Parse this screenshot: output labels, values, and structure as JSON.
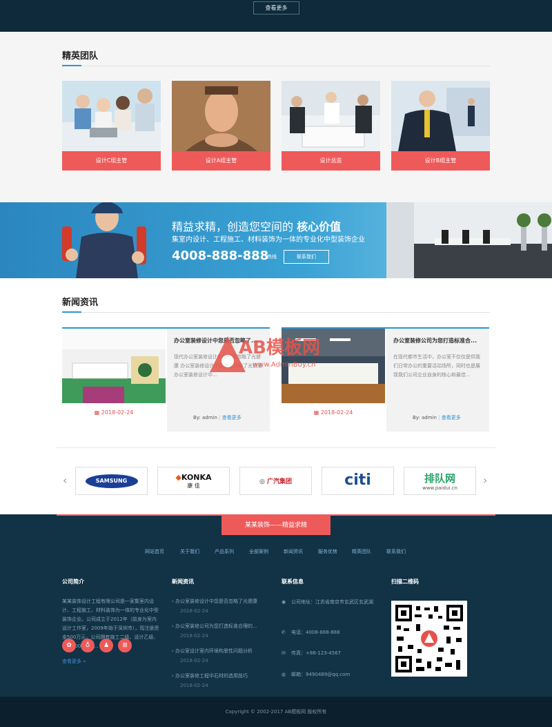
{
  "top": {
    "more_button": "查看更多"
  },
  "team": {
    "title": "精英团队",
    "members": [
      {
        "caption": "设计C组主管"
      },
      {
        "caption": "设计A组主管"
      },
      {
        "caption": "设计总监"
      },
      {
        "caption": "设计B组主管"
      }
    ]
  },
  "banner": {
    "headline_pre": "精益求精，创造您空间的",
    "headline_bold": "核心价值",
    "subline": "集室内设计、工程施工、材料装饰为一体的专业化中型装饰企业",
    "phone": "4008-888-888",
    "phone_suffix": "热线",
    "contact_button": "联系我们"
  },
  "news": {
    "title": "新闻资讯",
    "items": [
      {
        "title": "办公室装修设计中您是否忽略了...",
        "desc": "现代办公室装修设计中您是否忽略了光健康 办公室装修设计中您是否忽略了光健康 办公室装修设计中...",
        "date": "2018-02-24",
        "author": "By: admin",
        "more": "查看更多"
      },
      {
        "title": "办公室装修公司为您打造标准合...",
        "desc": "在现代都市生活中，办公室不仅仅是供我们日常办公的重要活动场所，同时也是展现我们公司企业自身的核心和最佳...",
        "date": "2018-02-24",
        "author": "By: admin",
        "more": "查看更多"
      }
    ]
  },
  "watermark": {
    "brand": "AB模板网",
    "url": "www.AdminBuy.cn"
  },
  "partners": [
    {
      "name": "SAMSUNG"
    },
    {
      "name": "KONKA",
      "sub": "康 佳"
    },
    {
      "name": "广汽集团"
    },
    {
      "name": "citi"
    },
    {
      "name": "排队网",
      "sub": "www.paidui.cn"
    }
  ],
  "footer": {
    "tagline": "某某装饰——精益求精",
    "nav": [
      "网站首页",
      "关于我们",
      "产品系列",
      "全部案例",
      "新闻资讯",
      "服务优势",
      "精英团队",
      "联系我们"
    ],
    "about_title": "公司简介",
    "about_text": "某某装饰设计工程有限公司是一家集室内设计、工程施工、材料装饰为一体的专业化中型装饰企业。公司成立于2012年（前身为室内设计工作室，2009年始于深圳市），现注册资金500万元，公司拥有施工二级、设计乙级、承接1000万元...",
    "about_more": "查看更多 »",
    "news_title": "新闻资讯",
    "news_list": [
      {
        "title": "办公室装修设计中您是否忽略了光健康",
        "date": "2018-02-24"
      },
      {
        "title": "办公室装修公司为您打造标准合理的...",
        "date": "2018-02-24"
      },
      {
        "title": "办公室设计室内环境构思性问题分析",
        "date": "2018-02-24"
      },
      {
        "title": "办公室装修工程中石材的选用技巧",
        "date": "2018-02-24"
      }
    ],
    "contact_title": "联系信息",
    "address": "公司地址：江苏省南京市玄武区玄武湖",
    "phone": "电话：4008-888-888",
    "fax": "传真：+86-123-4567",
    "email": "邮箱：9490489@qq.com",
    "qr_title": "扫描二维码",
    "copyright": "Copyright © 2002-2017 AB模板网 版权所有"
  }
}
